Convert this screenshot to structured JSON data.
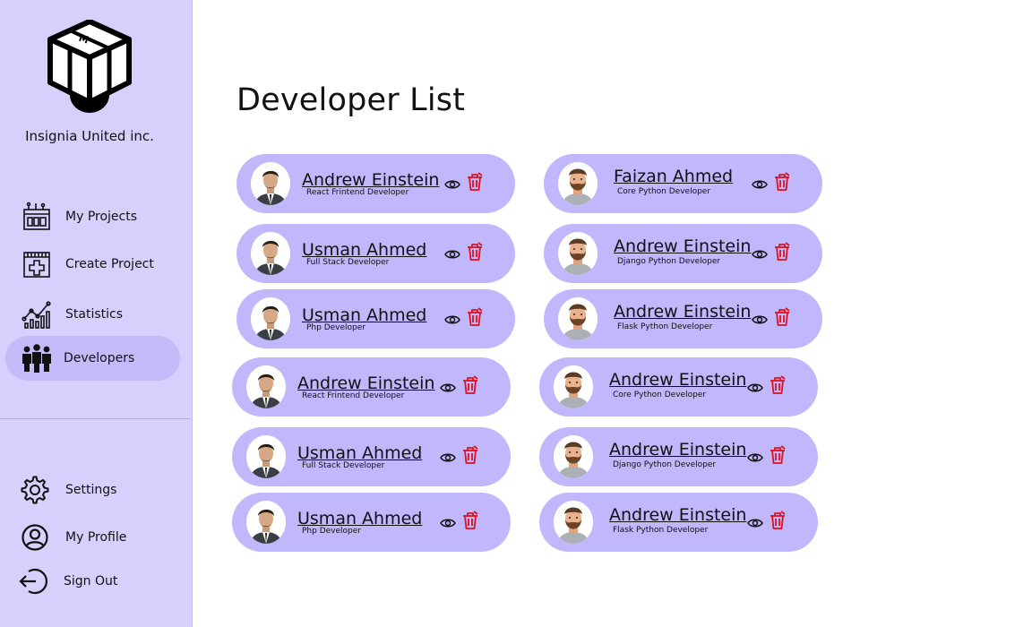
{
  "sidebar": {
    "company_name": "Insignia United inc.",
    "nav": [
      {
        "label": "My Projects",
        "icon": "projects-icon"
      },
      {
        "label": "Create Project",
        "icon": "create-project-icon"
      },
      {
        "label": "Statistics",
        "icon": "statistics-icon"
      },
      {
        "label": "Developers",
        "icon": "developers-icon",
        "active": true
      }
    ],
    "bottom_nav": [
      {
        "label": "Settings",
        "icon": "gear-icon"
      },
      {
        "label": "My Profile",
        "icon": "profile-icon"
      },
      {
        "label": "Sign Out",
        "icon": "sign-out-icon"
      }
    ]
  },
  "main": {
    "title": "Developer List",
    "developers_left": [
      {
        "name": "Andrew Einstein",
        "role": "React Frintend Developer"
      },
      {
        "name": "Usman Ahmed",
        "role": "Full Stack Developer"
      },
      {
        "name": "Usman Ahmed",
        "role": "Php Developer"
      },
      {
        "name": "Andrew Einstein",
        "role": "React Frintend Developer"
      },
      {
        "name": "Usman Ahmed",
        "role": "Full Stack Developer"
      },
      {
        "name": "Usman Ahmed",
        "role": "Php Developer"
      }
    ],
    "developers_right": [
      {
        "name": "Faizan Ahmed",
        "role": "Core Python Developer"
      },
      {
        "name": "Andrew Einstein",
        "role": "Django Python Developer"
      },
      {
        "name": "Andrew Einstein",
        "role": "Flask Python Developer"
      },
      {
        "name": "Andrew Einstein",
        "role": "Core Python Developer"
      },
      {
        "name": "Andrew Einstein",
        "role": "Django Python Developer"
      },
      {
        "name": "Andrew Einstein",
        "role": "Flask Python Developer"
      }
    ]
  },
  "colors": {
    "sidebar_bg": "#d6d0fd",
    "active_nav": "#c4bbfb",
    "card_bg": "#c0b7fc",
    "trash": "#e0101c"
  }
}
